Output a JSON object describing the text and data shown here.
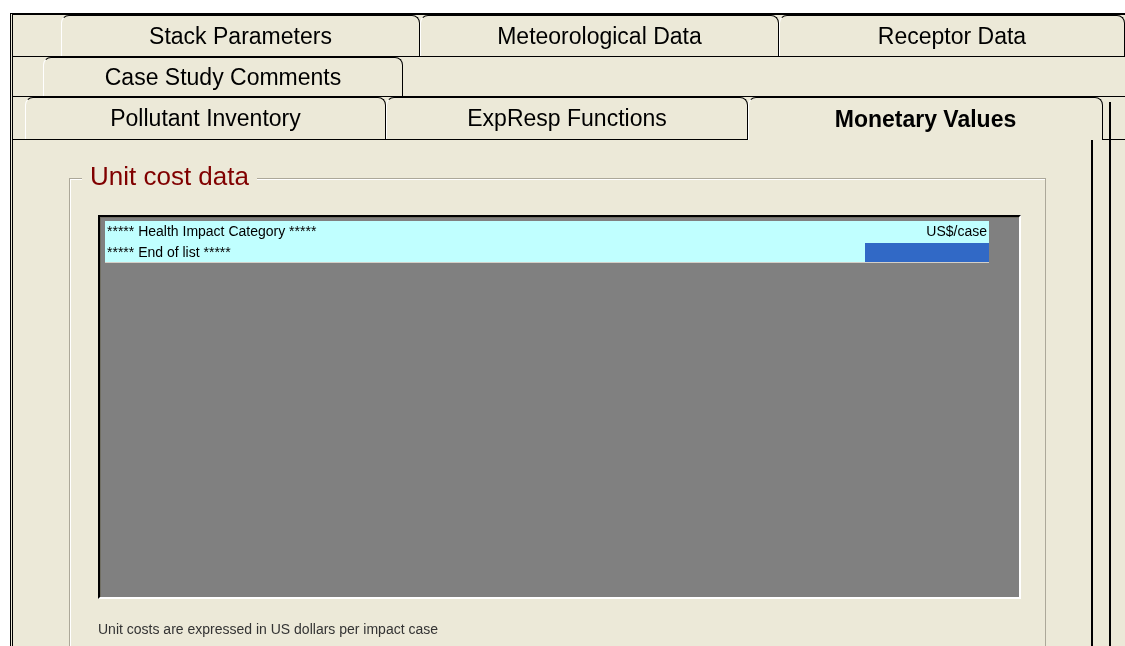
{
  "tab_rows": [
    {
      "tabs": [
        {
          "label": "Stack Parameters",
          "selected": false
        },
        {
          "label": "Meteorological Data",
          "selected": false
        },
        {
          "label": "Receptor Data",
          "selected": false
        }
      ]
    },
    {
      "tabs": [
        {
          "label": "Case Study Comments",
          "selected": false
        }
      ]
    },
    {
      "tabs": [
        {
          "label": "Pollutant Inventory",
          "selected": false
        },
        {
          "label": "ExpResp Functions",
          "selected": false
        },
        {
          "label": "Monetary Values",
          "selected": true
        }
      ]
    }
  ],
  "group": {
    "title": "Unit cost data",
    "list": {
      "rows": [
        {
          "label": "***** Health Impact Category *****",
          "value": "US$/case",
          "selected": false
        },
        {
          "label": "***** End of list *****",
          "selected": true
        }
      ]
    },
    "note": "Unit costs are expressed in US dollars per impact case"
  }
}
